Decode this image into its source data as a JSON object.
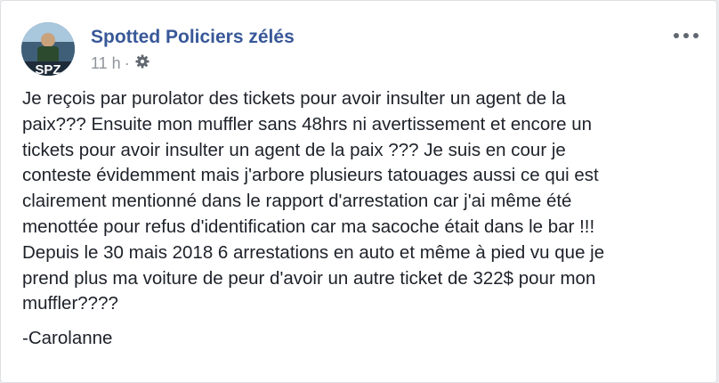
{
  "post": {
    "page_name": "Spotted Policiers zélés",
    "timestamp": "11 h",
    "separator": "·",
    "avatar_text": "SPZ",
    "icons": {
      "privacy": "gear-icon",
      "more": "more-options-icon"
    },
    "body_text": "Je reçois par purolator des tickets pour avoir insulter un agent de la\npaix??? Ensuite mon muffler sans 48hrs ni avertissement et encore un\ntickets pour avoir insulter un agent de la paix ??? Je suis en cour je\nconteste évidemment mais j'arbore plusieurs tatouages aussi ce qui est\nclairement mentionné dans le rapport d'arrestation car j'ai même été\nmenottée pour refus d'identification car ma sacoche était dans le bar !!!\nDepuis le 30 mais 2018 6 arrestations en auto et même à pied vu que je\nprend plus ma voiture de peur d'avoir un autre ticket de 322$ pour mon\nmuffler????",
    "signature": "-Carolanne"
  },
  "colors": {
    "link": "#385898",
    "meta": "#90949c",
    "text": "#1d2129",
    "background": "#e9ebee",
    "card": "#ffffff"
  }
}
